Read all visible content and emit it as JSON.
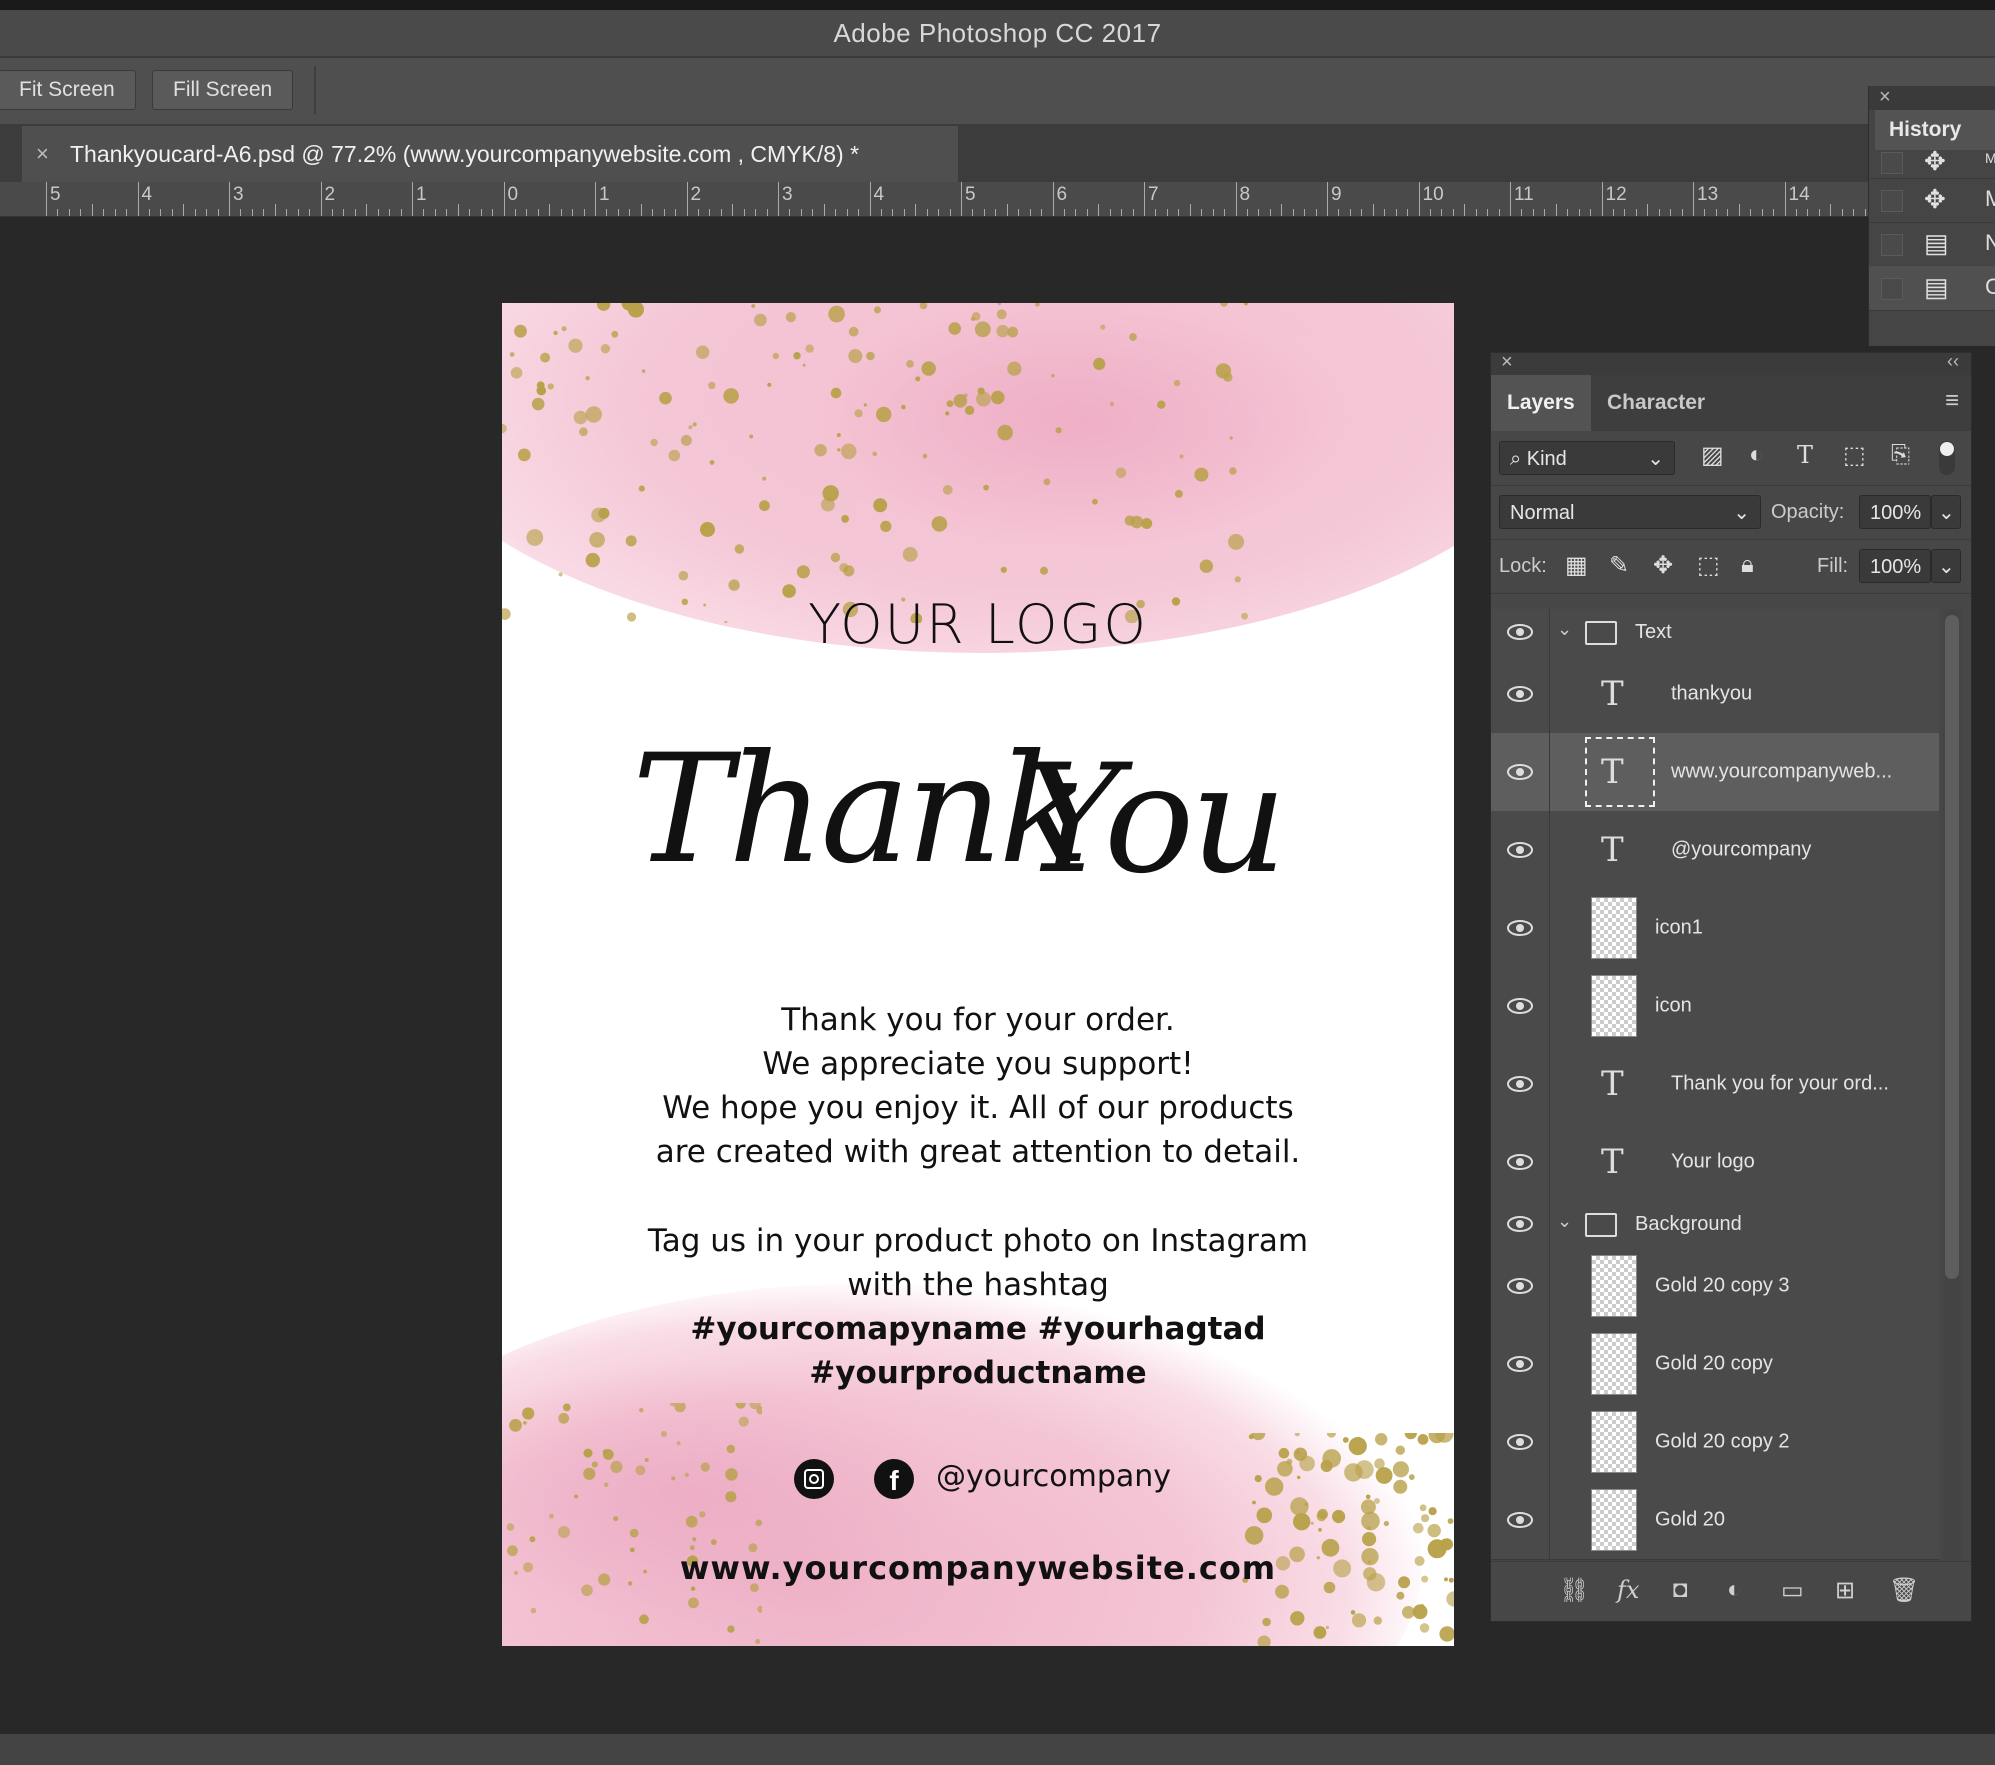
{
  "app": {
    "title": "Adobe Photoshop CC 2017"
  },
  "options_bar": {
    "fit_screen": "Fit Screen",
    "fill_screen": "Fill Screen"
  },
  "document_tab": {
    "close": "×",
    "title": "Thankyoucard-A6.psd @ 77.2% (www.yourcompanywebsite.com   , CMYK/8) *"
  },
  "ruler": {
    "labels": [
      "5",
      "4",
      "3",
      "2",
      "1",
      "0",
      "1",
      "2",
      "3",
      "4",
      "5",
      "6",
      "7",
      "8",
      "9",
      "10",
      "11",
      "12",
      "13",
      "14"
    ]
  },
  "card": {
    "logo": "YOUR LOGO",
    "script_thank": "Thank",
    "script_you": "You",
    "lines": [
      "Thank you for your order.",
      "We appreciate you support!",
      "We hope you enjoy it. All of our products",
      "are created with great attention to detail."
    ],
    "tag_lines": [
      "Tag us in your product photo on Instagram",
      "with the hashtag"
    ],
    "hashtags": [
      "#yourcomapyname #yourhagtad",
      "#yourproductname"
    ],
    "social_handle": "@yourcompany",
    "website": "www.yourcompanywebsite.com"
  },
  "history": {
    "close": "×",
    "tab": "History",
    "items": [
      {
        "icon": "move-icon",
        "label": "M"
      },
      {
        "icon": "move-icon",
        "label": "M"
      },
      {
        "icon": "document-icon",
        "label": "N"
      },
      {
        "icon": "document-icon",
        "label": "C"
      }
    ]
  },
  "layers_panel": {
    "close": "×",
    "collapse": "‹‹",
    "tabs": [
      "Layers",
      "Character"
    ],
    "kind_label": "Kind",
    "blend_mode": "Normal",
    "opacity_label": "Opacity:",
    "opacity_value": "100%",
    "lock_label": "Lock:",
    "fill_label": "Fill:",
    "fill_value": "100%",
    "groups": [
      "Text",
      "Background"
    ],
    "text_layers": [
      {
        "name": "thankyou",
        "kind": "text"
      },
      {
        "name": "www.yourcompanyweb...",
        "kind": "text",
        "selected": true
      },
      {
        "name": "@yourcompany",
        "kind": "text"
      },
      {
        "name": "icon1",
        "kind": "pixel"
      },
      {
        "name": "icon",
        "kind": "pixel"
      },
      {
        "name": "Thank you for your ord...",
        "kind": "text"
      },
      {
        "name": "Your logo",
        "kind": "text"
      }
    ],
    "background_layers": [
      {
        "name": "Gold 20 copy 3",
        "kind": "pixel"
      },
      {
        "name": "Gold 20 copy",
        "kind": "pixel"
      },
      {
        "name": "Gold 20 copy 2",
        "kind": "pixel"
      },
      {
        "name": "Gold 20",
        "kind": "pixel"
      }
    ]
  },
  "colors": {
    "canvas_bg": "#282828",
    "panel_bg": "#474747",
    "watercolor_pink": "#f4c6d6",
    "gold": "#b8a14a"
  }
}
